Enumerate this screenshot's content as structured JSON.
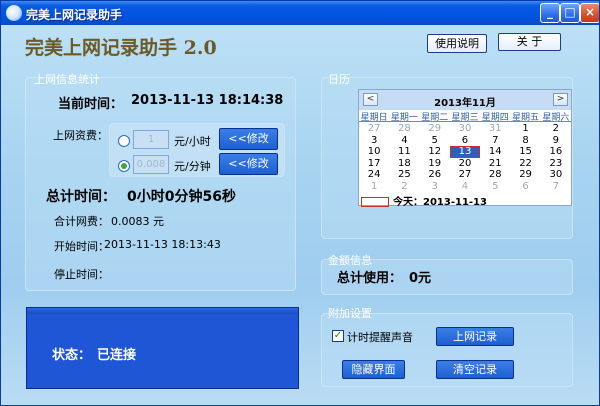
{
  "window": {
    "title": "完美上网记录助手",
    "minimize_label": "_",
    "maximize_label": "□",
    "close_label": "×"
  },
  "header": {
    "app_title": "完美上网记录助手 2.0",
    "help_button": "使用说明",
    "about_button": "关  于"
  },
  "stats": {
    "group_label": "上网信息统计",
    "current_time_label": "当前时间：",
    "current_time": "2013-11-13 18:14:38",
    "fee_label": "上网资费：",
    "rate_options": [
      {
        "value": "1",
        "unit": "元/小时",
        "selected": false,
        "modify": "<<修改"
      },
      {
        "value": "0.008",
        "unit": "元/分钟",
        "selected": true,
        "modify": "<<修改"
      }
    ],
    "total_time_label": "总计时间：",
    "total_time": "0小时0分钟56秒",
    "total_fee_label": "合计网费：",
    "total_fee": "0.0083 元",
    "start_time_label": "开始时间：",
    "start_time": "2013-11-13 18:13:43",
    "stop_time_label": "停止时间：",
    "stop_time": ""
  },
  "status": {
    "label": "状态：",
    "value": "已连接"
  },
  "calendar": {
    "group_label": "日历",
    "prev_label": "<",
    "next_label": ">",
    "month_title": "2013年11月",
    "weekdays": [
      "星期日",
      "星期一",
      "星期二",
      "星期三",
      "星期四",
      "星期五",
      "星期六"
    ],
    "weeks": [
      [
        "27",
        "28",
        "29",
        "30",
        "31",
        "1",
        "2"
      ],
      [
        "3",
        "4",
        "5",
        "6",
        "7",
        "8",
        "9"
      ],
      [
        "10",
        "11",
        "12",
        "13",
        "14",
        "15",
        "16"
      ],
      [
        "17",
        "18",
        "19",
        "20",
        "21",
        "22",
        "23"
      ],
      [
        "24",
        "25",
        "26",
        "27",
        "28",
        "29",
        "30"
      ],
      [
        "1",
        "2",
        "3",
        "4",
        "5",
        "6",
        "7"
      ]
    ],
    "other_month_rows": {
      "first": [
        0,
        1,
        2,
        3,
        4
      ],
      "last": [
        0,
        1,
        2,
        3,
        4,
        5,
        6
      ]
    },
    "selected_day": "13",
    "today_label": "今天：",
    "today_date": "2013-11-13"
  },
  "amount": {
    "group_label": "金额信息",
    "total_label": "总计使用：",
    "total_value": "0元"
  },
  "extras": {
    "group_label": "附加设置",
    "sound_checkbox_label": "计时提醒声音",
    "sound_checked": true,
    "log_button": "上网记录",
    "hide_button": "隐藏界面",
    "clear_button": "清空记录"
  }
}
